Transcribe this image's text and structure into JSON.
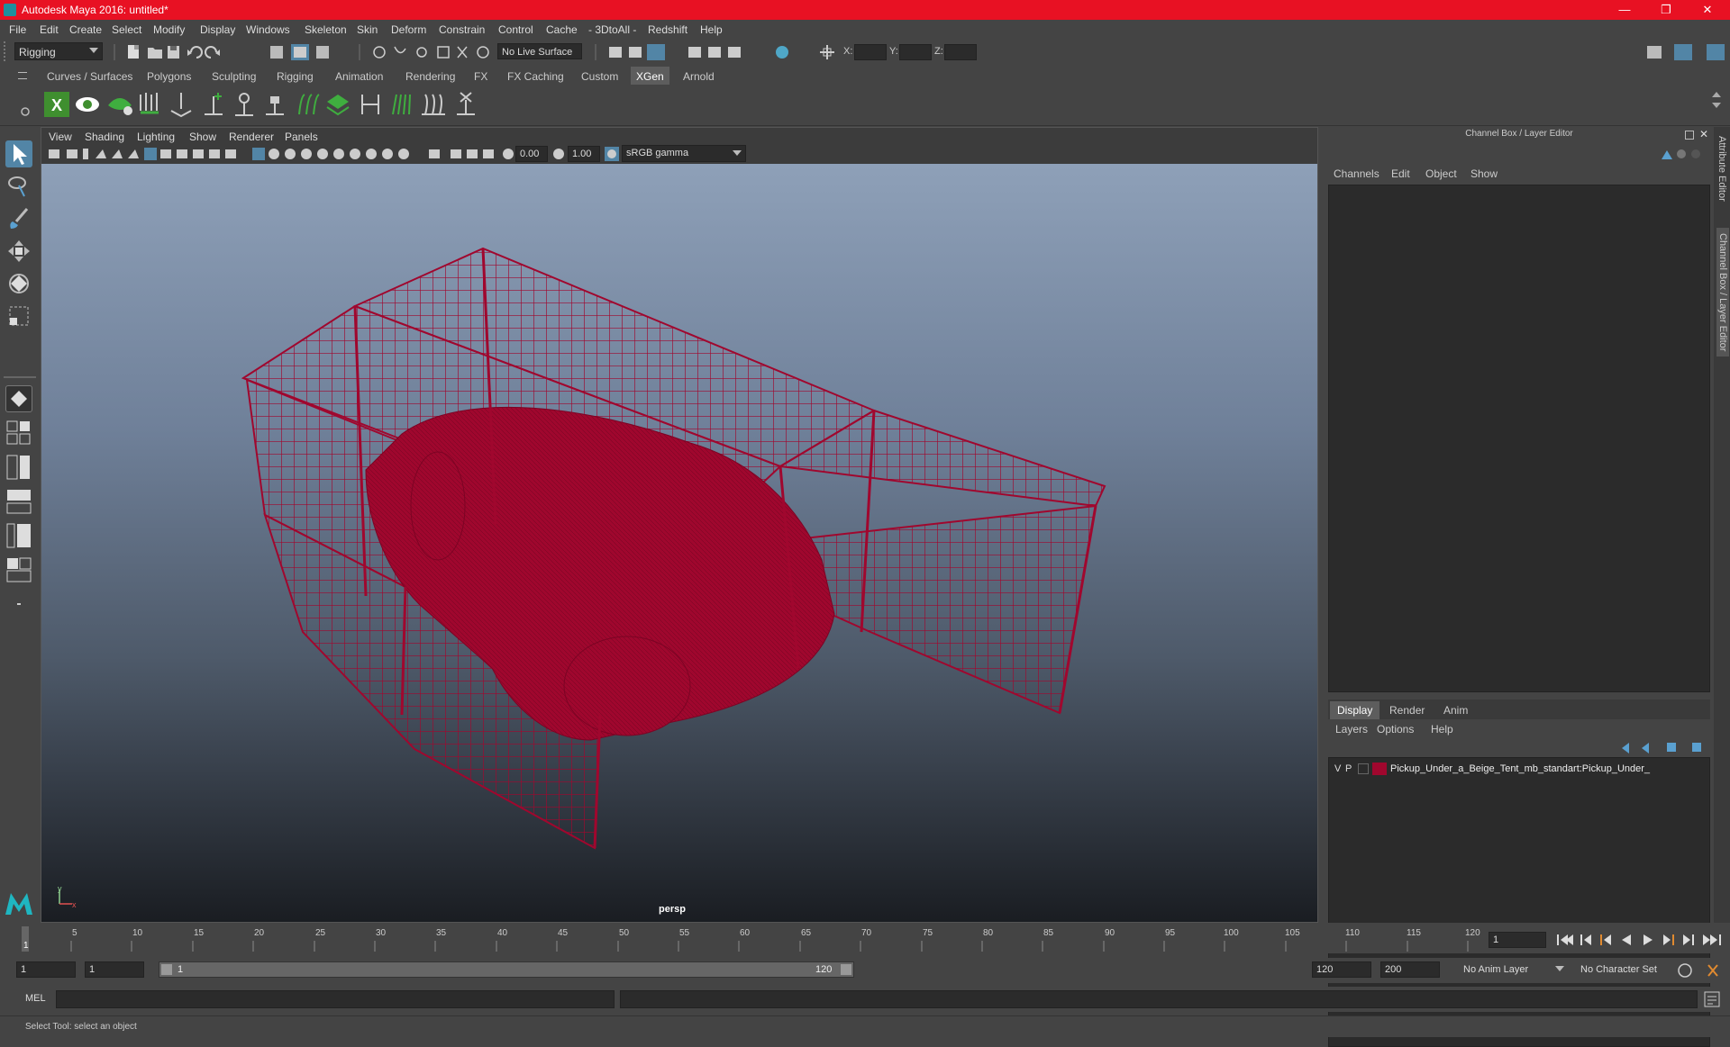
{
  "window": {
    "title": "Autodesk Maya 2016: untitled*"
  },
  "menu": [
    "File",
    "Edit",
    "Create",
    "Select",
    "Modify",
    "Display",
    "Windows",
    "Skeleton",
    "Skin",
    "Deform",
    "Constrain",
    "Control",
    "Cache",
    "- 3DtoAll -",
    "Redshift",
    "Help"
  ],
  "status_line": {
    "mode": "Rigging",
    "live_surface": "No Live Surface",
    "x_label": "X:",
    "y_label": "Y:",
    "z_label": "Z:"
  },
  "shelf_tabs": [
    "Curves / Surfaces",
    "Polygons",
    "Sculpting",
    "Rigging",
    "Animation",
    "Rendering",
    "FX",
    "FX Caching",
    "Custom",
    "XGen",
    "Arnold"
  ],
  "active_shelf_tab": "XGen",
  "viewport": {
    "menu": [
      "View",
      "Shading",
      "Lighting",
      "Show",
      "Renderer",
      "Panels"
    ],
    "exposure": "0.00",
    "gamma": "1.00",
    "color_space": "sRGB gamma",
    "camera": "persp",
    "axis_y": "y",
    "axis_x": "x"
  },
  "channel_box": {
    "title": "Channel Box / Layer Editor",
    "menu": [
      "Channels",
      "Edit",
      "Object",
      "Show"
    ]
  },
  "layer_editor": {
    "tabs": [
      "Display",
      "Render",
      "Anim"
    ],
    "menu": [
      "Layers",
      "Options",
      "Help"
    ],
    "layers": [
      {
        "v": "V",
        "p": "P",
        "name": "Pickup_Under_a_Beige_Tent_mb_standart:Pickup_Under_",
        "color": "#a0072e"
      }
    ]
  },
  "side_tabs": [
    "Attribute Editor",
    "Channel Box / Layer Editor"
  ],
  "timeline": {
    "ticks": [
      "1",
      "5",
      "10",
      "15",
      "20",
      "25",
      "30",
      "35",
      "40",
      "45",
      "50",
      "55",
      "60",
      "65",
      "70",
      "75",
      "80",
      "85",
      "90",
      "95",
      "100",
      "105",
      "110",
      "115",
      "120"
    ],
    "current_frame": "1",
    "current_frame_field": "1"
  },
  "range": {
    "start": "1",
    "playback_start": "1",
    "slider_start": "1",
    "slider_end": "120",
    "playback_end": "120",
    "end": "200",
    "anim_layer": "No Anim Layer",
    "character_set": "No Character Set"
  },
  "command_line": {
    "language": "MEL"
  },
  "help_line": {
    "text": "Select Tool: select an object"
  },
  "colors": {
    "wireframe": "#a0072e",
    "title_bar": "#e81123",
    "active_tab": "#5d5d5d"
  }
}
